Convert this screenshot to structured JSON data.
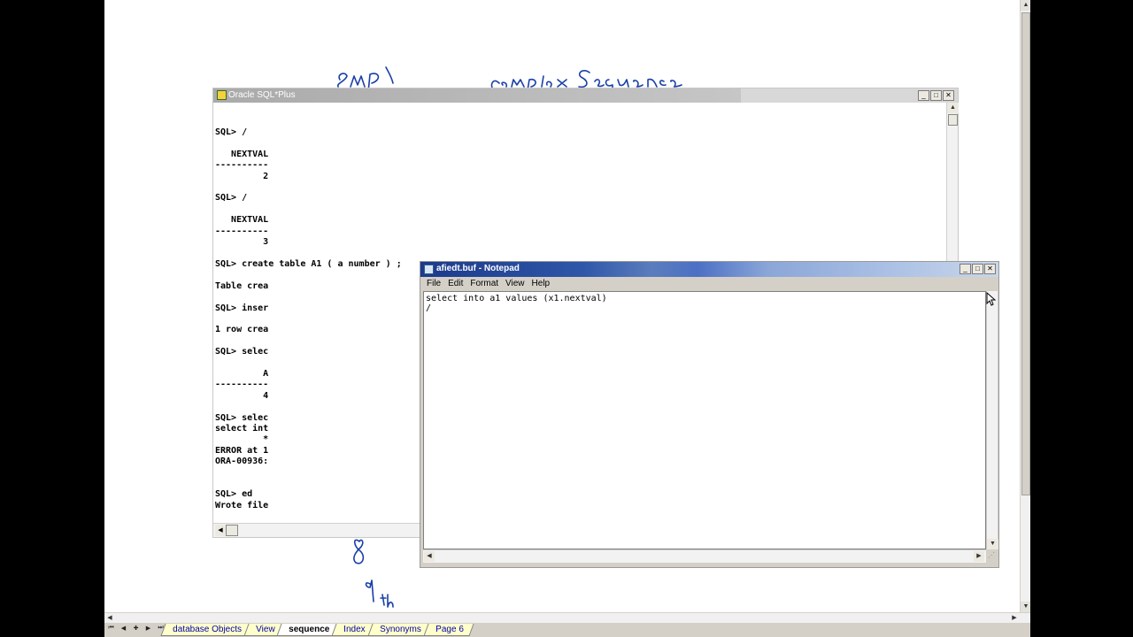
{
  "workbook": {
    "tabs": [
      "database Objects",
      "View",
      "sequence",
      "Index",
      "Synonyms",
      "Page 6"
    ],
    "active_tab": "sequence",
    "nav_glyphs": [
      "⏮",
      "◀",
      "✚",
      "▶",
      "⏭"
    ]
  },
  "sqlplus": {
    "title": "Oracle SQL*Plus",
    "output": "SQL> /\n\n   NEXTVAL\n----------\n         2\n\nSQL> /\n\n   NEXTVAL\n----------\n         3\n\nSQL> create table A1 ( a number ) ;\n\nTable crea\n\nSQL> inser\n\n1 row crea\n\nSQL> selec\n\n         A\n----------\n         4\n\nSQL> selec\nselect int\n         *\nERROR at 1\nORA-00936:\n\n\nSQL> ed\nWrote file"
  },
  "notepad": {
    "title": "afiedt.buf - Notepad",
    "menu": [
      "File",
      "Edit",
      "Format",
      "View",
      "Help"
    ],
    "content": "select into a1 values (x1.nextval)\n/"
  },
  "window_controls": {
    "minimize": "_",
    "maximize": "□",
    "close": "✕"
  },
  "colors": {
    "notepad_title": "#2f56a8",
    "ink": "#1a3fa8",
    "tab_bg": "#ffffcc"
  }
}
